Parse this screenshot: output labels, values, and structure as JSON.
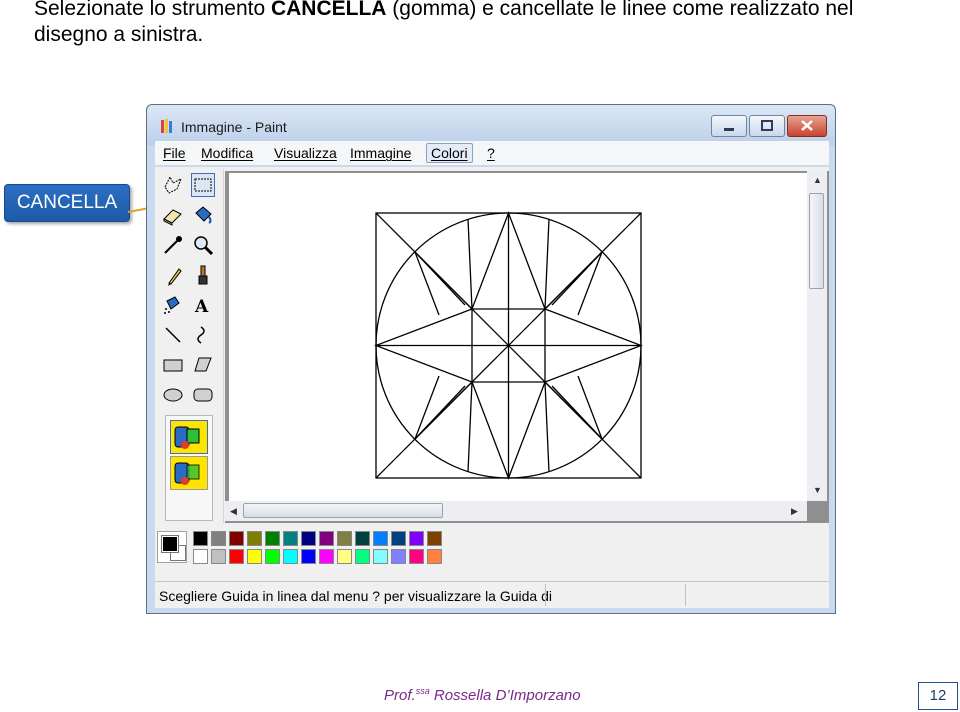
{
  "slide": {
    "instruction_pre": "Selezionate lo strumento ",
    "instruction_bold": "CANCELLA",
    "instruction_post": " (gomma) e cancellate le linee come realizzato  nel disegno a sinistra.",
    "callout_label": "CANCELLA",
    "footer_prefix": "Prof.",
    "footer_sup": "ssa",
    "footer_name": " Rossella D’Imporzano",
    "page_number": "12"
  },
  "window": {
    "title": "Immagine - Paint",
    "menu": [
      "File",
      "Modifica",
      "Visualizza",
      "Immagine",
      "Colori",
      "?"
    ],
    "active_menu": "Colori",
    "status_text": "Scegliere Guida in linea dal menu ? per visualizzare la Guida di",
    "tools": [
      {
        "name": "free-select-icon"
      },
      {
        "name": "rect-select-icon"
      },
      {
        "name": "eraser-icon"
      },
      {
        "name": "fill-icon"
      },
      {
        "name": "color-picker-icon"
      },
      {
        "name": "magnifier-icon"
      },
      {
        "name": "pencil-icon"
      },
      {
        "name": "brush-icon"
      },
      {
        "name": "airbrush-icon"
      },
      {
        "name": "text-icon"
      },
      {
        "name": "line-icon"
      },
      {
        "name": "curve-icon"
      },
      {
        "name": "rectangle-icon"
      },
      {
        "name": "polygon-icon"
      },
      {
        "name": "ellipse-icon"
      },
      {
        "name": "rounded-rect-icon"
      }
    ],
    "selected_tool": "rect-select-icon",
    "palette_row1": [
      "#000000",
      "#808080",
      "#800000",
      "#808000",
      "#008000",
      "#008080",
      "#000080",
      "#800080",
      "#808040",
      "#004040",
      "#0080ff",
      "#004080",
      "#8000ff",
      "#804000"
    ],
    "palette_row2": [
      "#ffffff",
      "#c0c0c0",
      "#ff0000",
      "#ffff00",
      "#00ff00",
      "#00ffff",
      "#0000ff",
      "#ff00ff",
      "#ffff80",
      "#00ff80",
      "#80ffff",
      "#8080ff",
      "#ff0080",
      "#ff8040"
    ]
  }
}
